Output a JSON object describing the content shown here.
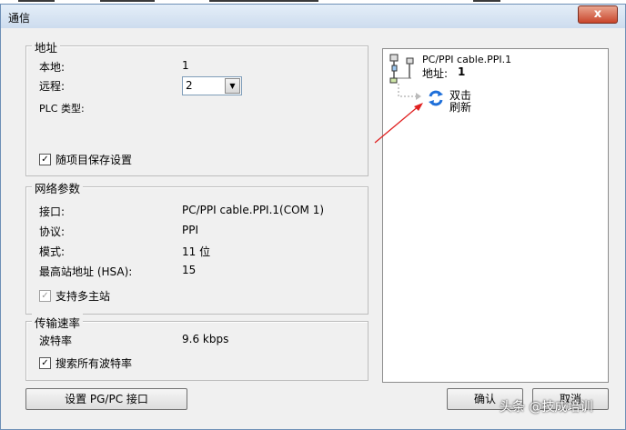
{
  "window": {
    "title": "通信",
    "close_label": "x"
  },
  "address_group": {
    "legend": "地址",
    "local_label": "本地:",
    "local_value": "1",
    "remote_label": "远程:",
    "remote_value": "2",
    "plc_type_label": "PLC 类型:",
    "save_settings_label": "随项目保存设置",
    "save_settings_checked": true
  },
  "network_group": {
    "legend": "网络参数",
    "interface_label": "接口:",
    "interface_value": "PC/PPI cable.PPI.1(COM 1)",
    "protocol_label": "协议:",
    "protocol_value": "PPI",
    "mode_label": "模式:",
    "mode_value": "11 位",
    "hsa_label": "最高站地址 (HSA):",
    "hsa_value": "15",
    "multimaster_label": "支持多主站",
    "multimaster_checked": true
  },
  "baud_group": {
    "legend": "传输速率",
    "baud_label": "波特率",
    "baud_value": "9.6 kbps",
    "search_all_label": "搜索所有波特率",
    "search_all_checked": true
  },
  "tree": {
    "cable_name": "PC/PPI cable.PPI.1",
    "address_label": "地址:",
    "address_value": "1",
    "refresh_line1": "双击",
    "refresh_line2": "刷新"
  },
  "buttons": {
    "set_pgpc": "设置 PG/PC 接口",
    "ok": "确认",
    "cancel": "取消"
  },
  "watermark": "头条 @技成培训",
  "colors": {
    "annotation_arrow": "#e02020",
    "refresh_icon": "#1e6fd9",
    "titlebar": "#cddcee"
  }
}
